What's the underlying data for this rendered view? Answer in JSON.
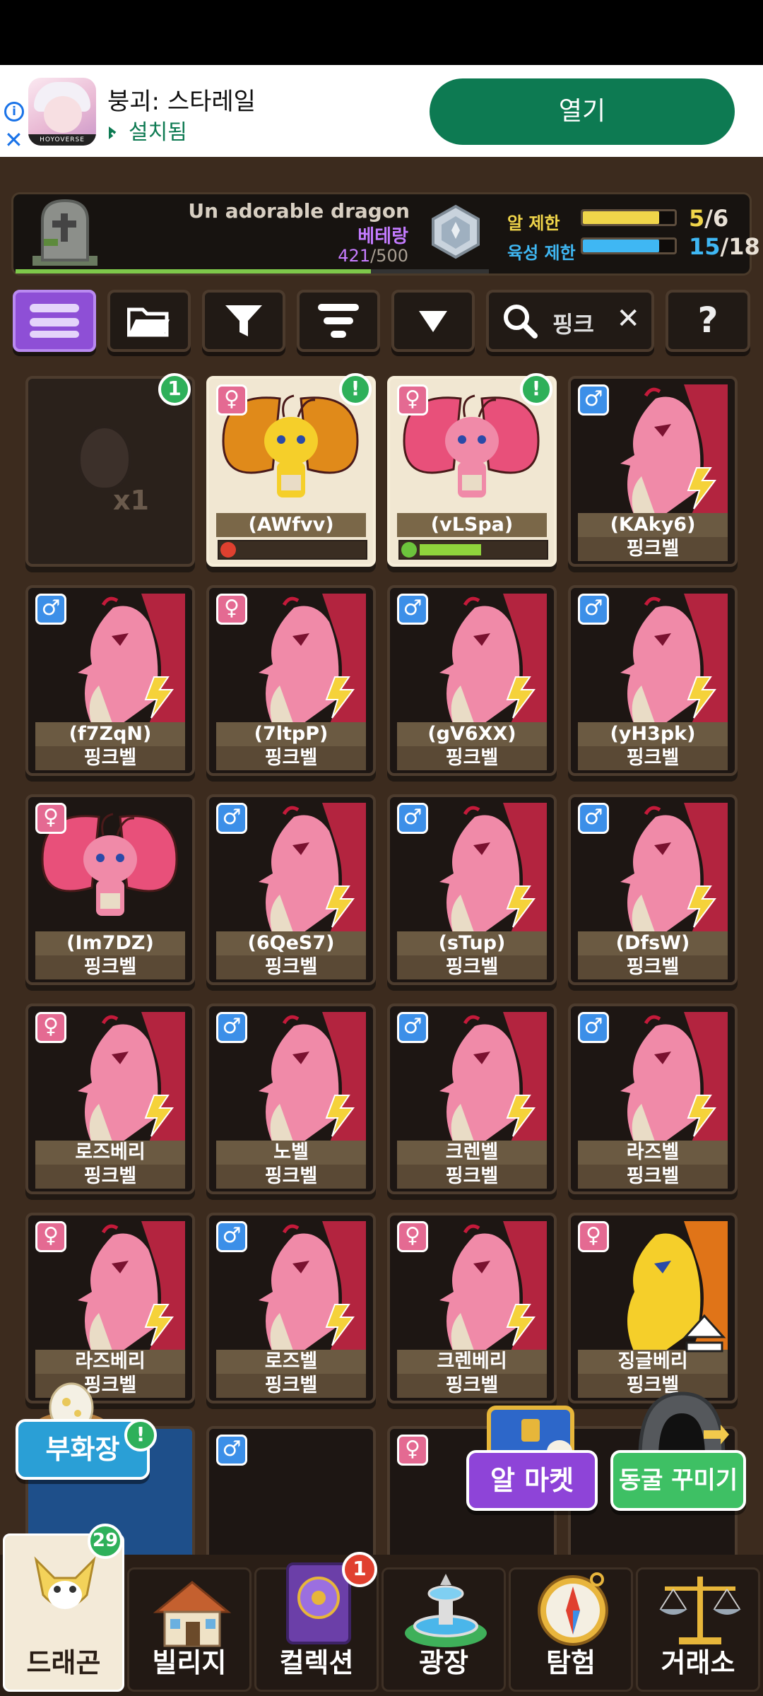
{
  "ad": {
    "title": "붕괴: 스타레일",
    "status": "설치됨",
    "open_label": "열기",
    "brand": "HOYOVERSE",
    "info_icon": "info-icon",
    "close_icon": "close-icon"
  },
  "header": {
    "dragon_name": "Un adorable dragon",
    "dragon_kind": "베테랑",
    "level_current": "421",
    "level_max": "/500",
    "xp_fraction": 0.75,
    "limits": [
      {
        "label": "알 제한",
        "current": "5",
        "max": "/6",
        "fill": 0.83,
        "color": "#f0d54a"
      },
      {
        "label": "육성 제한",
        "current": "15",
        "max": "/18",
        "fill": 0.83,
        "color": "#3fb7f3"
      }
    ]
  },
  "toolbar": {
    "search_value": "핑크",
    "help_label": "?",
    "icons": [
      "menu-icon",
      "folder-icon",
      "filter-icon",
      "sort-icon",
      "collapse-icon",
      "search-icon",
      "clear-icon",
      "help-icon"
    ]
  },
  "cards": [
    {
      "type": "egg",
      "count": "x1",
      "badge": "1"
    },
    {
      "gender": "♀",
      "name": "(AWfvv)",
      "mood": "bad",
      "mood_fill": 0.0,
      "badge": "!"
    },
    {
      "gender": "♀",
      "name": "(vLSpa)",
      "mood": "good",
      "mood_fill": 0.58,
      "badge": "!"
    },
    {
      "gender": "♂",
      "name": "(KAky6)",
      "species": "핑크벨"
    },
    {
      "gender": "♂",
      "name": "(f7ZqN)",
      "species": "핑크벨"
    },
    {
      "gender": "♀",
      "name": "(7ltpP)",
      "species": "핑크벨"
    },
    {
      "gender": "♂",
      "name": "(gV6XX)",
      "species": "핑크벨"
    },
    {
      "gender": "♂",
      "name": "(yH3pk)",
      "species": "핑크벨"
    },
    {
      "gender": "♀",
      "name": "(Im7DZ)",
      "species": "핑크벨"
    },
    {
      "gender": "♂",
      "name": "(6QeS7)",
      "species": "핑크벨"
    },
    {
      "gender": "♂",
      "name": "(sTup)",
      "species": "핑크벨"
    },
    {
      "gender": "♂",
      "name": "(DfsW)",
      "species": "핑크벨"
    },
    {
      "gender": "♀",
      "name": "로즈베리",
      "species": "핑크벨"
    },
    {
      "gender": "♂",
      "name": "노벨",
      "species": "핑크벨"
    },
    {
      "gender": "♂",
      "name": "크렌벨",
      "species": "핑크벨"
    },
    {
      "gender": "♂",
      "name": "라즈벨",
      "species": "핑크벨"
    },
    {
      "gender": "♀",
      "name": "라즈베리",
      "species": "핑크벨"
    },
    {
      "gender": "♂",
      "name": "로즈벨",
      "species": "핑크벨"
    },
    {
      "gender": "♀",
      "name": "크렌베리",
      "species": "핑크벨"
    },
    {
      "gender": "♀",
      "name": "징글베리",
      "species": "핑크벨"
    }
  ],
  "floating": {
    "hatchery": "부화장",
    "hatchery_badge": "!",
    "egg_market": "알 마켓",
    "cave_decor": "동굴 꾸미기"
  },
  "nav": {
    "items": [
      "드래곤",
      "빌리지",
      "컬렉션",
      "광장",
      "탐험",
      "거래소"
    ],
    "dragon_badge": "29",
    "collection_badge": "1"
  }
}
